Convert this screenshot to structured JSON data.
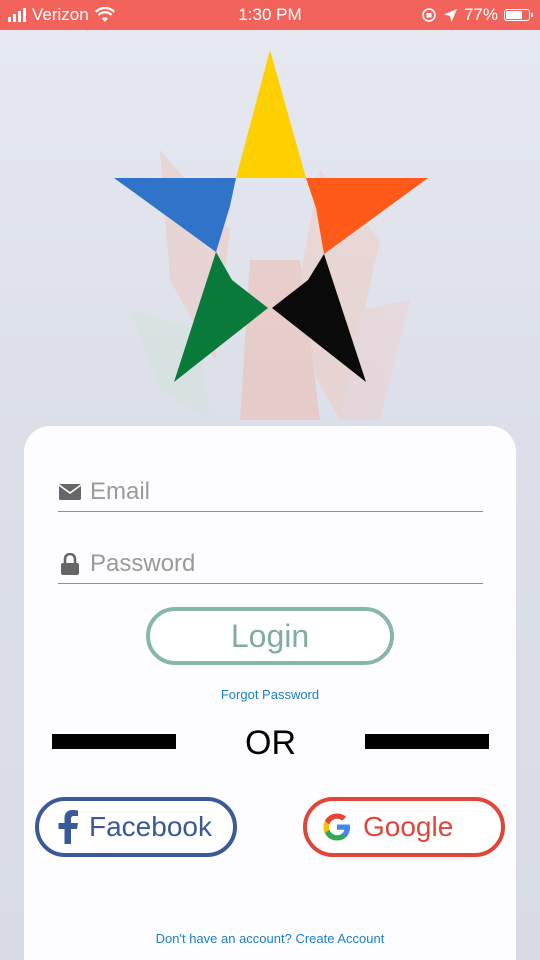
{
  "status_bar": {
    "carrier": "Verizon",
    "time": "1:30 PM",
    "battery": "77%",
    "battery_level": 0.77
  },
  "login_form": {
    "email_placeholder": "Email",
    "password_placeholder": "Password",
    "login_label": "Login",
    "forgot_password": "Forgot Password",
    "divider_label": "OR"
  },
  "social": {
    "facebook_label": "Facebook",
    "google_label": "Google"
  },
  "footer": {
    "prompt": "Don't have an account?",
    "create_account": "Create Account"
  },
  "colors": {
    "status_bar": "#f2645b",
    "login_border": "#86b8a8",
    "facebook": "#3b5998",
    "google": "#e0463a",
    "link": "#1a7fd1",
    "star_yellow": "#ffd000",
    "star_orange": "#ff5a1a",
    "star_blue": "#2f74c9",
    "star_green": "#0a7a3a",
    "star_black": "#0a0a0a"
  },
  "icons": {
    "email": "envelope-icon",
    "password": "lock-icon",
    "facebook": "facebook-icon",
    "google": "google-icon"
  }
}
